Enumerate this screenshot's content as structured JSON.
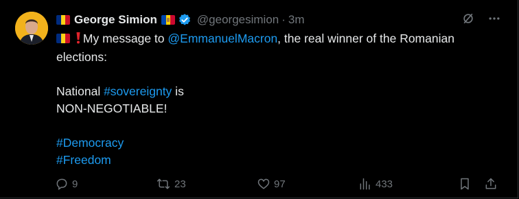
{
  "author": {
    "name": "George Simion",
    "handle": "@georgesimion",
    "separator": "·",
    "time": "3m"
  },
  "tweet": {
    "line1_prefix": "My message to ",
    "line1_mention": "@EmmanuelMacron",
    "line1_suffix": ", the real winner of the Romanian",
    "line2": "elections:",
    "line3_prefix": "National ",
    "line3_hashtag": "#sovereignty",
    "line3_suffix": " is",
    "line4": "NON-NEGOTIABLE!",
    "hashtag_democracy": "#Democracy",
    "hashtag_freedom": "#Freedom"
  },
  "actions": {
    "reply_count": "9",
    "retweet_count": "23",
    "like_count": "97",
    "views_count": "433"
  },
  "icons": {
    "grok": "slash-circle-icon",
    "more": "more-dots-icon",
    "reply": "reply-icon",
    "retweet": "retweet-icon",
    "like": "heart-icon",
    "views": "views-icon",
    "bookmark": "bookmark-icon",
    "share": "share-icon"
  },
  "colors": {
    "background": "#000000",
    "text": "#e7e9ea",
    "muted": "#71767b",
    "link": "#1d9bf0",
    "verified": "#1d9bf0",
    "flag_blue": "#002b7f",
    "flag_yellow": "#fcd116",
    "flag_red": "#ce1126"
  }
}
